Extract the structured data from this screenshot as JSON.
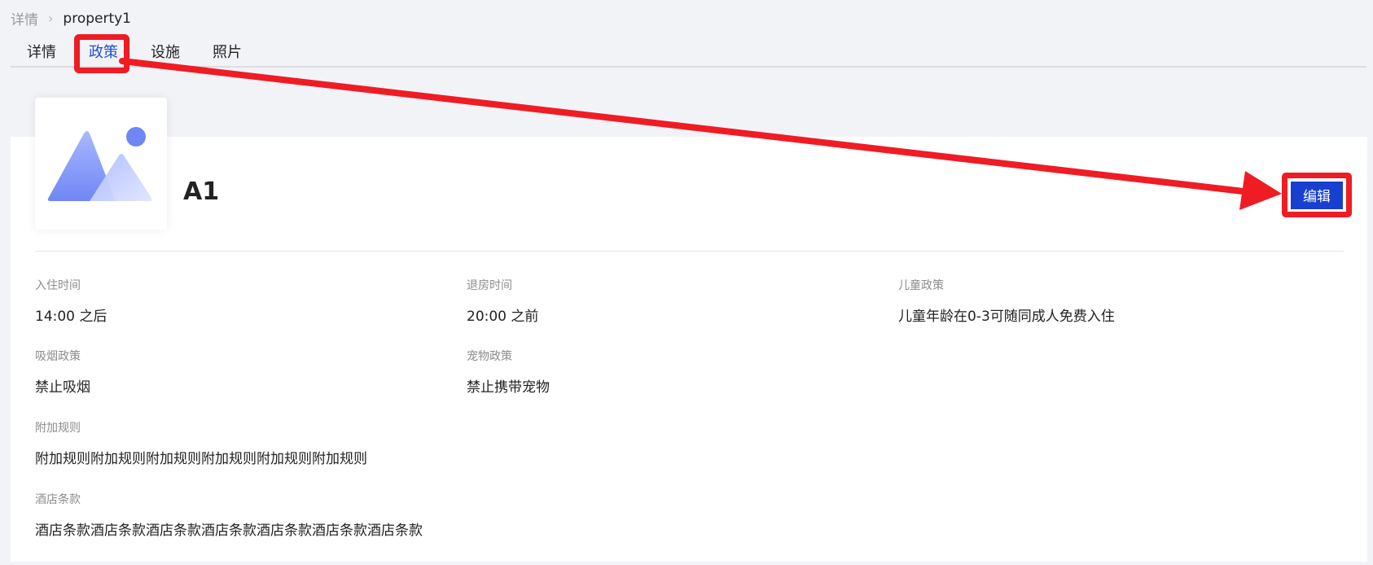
{
  "breadcrumb": {
    "parent": "详情",
    "current": "property1"
  },
  "tabs": [
    {
      "label": "详情"
    },
    {
      "label": "政策"
    },
    {
      "label": "设施"
    },
    {
      "label": "照片"
    }
  ],
  "active_tab": "政策",
  "property": {
    "name": "A1",
    "edit_label": "编辑"
  },
  "fields": {
    "checkin": {
      "label": "入住时间",
      "value": "14:00 之后"
    },
    "checkout": {
      "label": "退房时间",
      "value": "20:00 之前"
    },
    "children": {
      "label": "儿童政策",
      "value": "儿童年龄在0-3可随同成人免费入住"
    },
    "smoking": {
      "label": "吸烟政策",
      "value": "禁止吸烟"
    },
    "pets": {
      "label": "宠物政策",
      "value": "禁止携带宠物"
    },
    "extra": {
      "label": "附加规则",
      "value": "附加规则附加规则附加规则附加规则附加规则附加规则"
    },
    "terms": {
      "label": "酒店条款",
      "value": "酒店条款酒店条款酒店条款酒店条款酒店条款酒店条款酒店条款"
    }
  },
  "colors": {
    "accent": "#1f4fd1",
    "button": "#1840d0",
    "annotation": "#ef1c24",
    "background": "#f2f3f6"
  },
  "icons": {
    "thumbnail": "image-placeholder-icon",
    "separator": "chevron-right-icon"
  }
}
